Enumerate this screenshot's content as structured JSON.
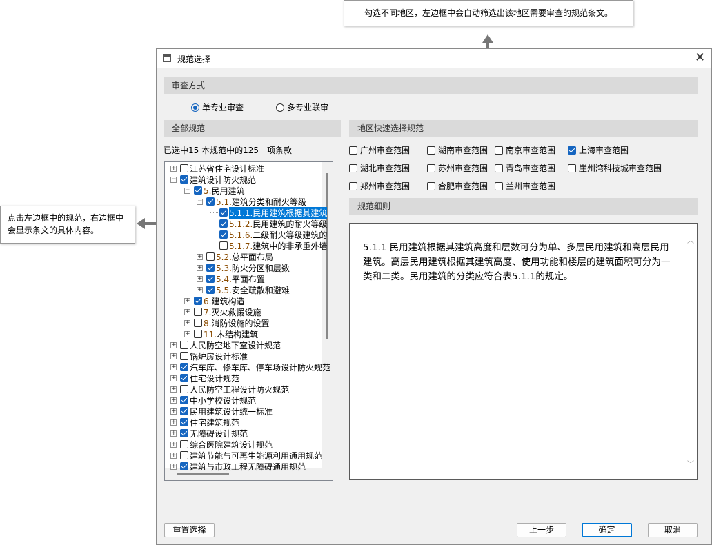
{
  "annotations": {
    "top": "勾选不同地区，左边框中会自动筛选出该地区需要审查的规范条文。",
    "left": "点击左边框中的规范，右边框中会显示条文的具体内容。"
  },
  "dialog": {
    "title": "规范选择",
    "review_mode": {
      "header": "审查方式",
      "options": [
        {
          "label": "单专业审查",
          "selected": true
        },
        {
          "label": "多专业联审",
          "selected": false
        }
      ]
    },
    "all_specs": {
      "header": "全部规范",
      "summary": "已选中15 本规范中的125　项条款"
    },
    "tree": [
      {
        "label": "江苏省住宅设计标准",
        "level": 0,
        "checked": false,
        "exp": "+"
      },
      {
        "label": "建筑设计防火规范",
        "level": 0,
        "checked": true,
        "exp": "-"
      },
      {
        "num": "5.",
        "label": "民用建筑",
        "level": 1,
        "checked": true,
        "exp": "-"
      },
      {
        "num": "5.1.",
        "label": "建筑分类和耐火等级",
        "level": 2,
        "checked": true,
        "exp": "-"
      },
      {
        "num": "5.1.1.",
        "label": "民用建筑根据其建筑",
        "level": 3,
        "checked": true,
        "exp": "",
        "selected": true
      },
      {
        "num": "5.1.2.",
        "label": "民用建筑的耐火等级",
        "level": 3,
        "checked": true,
        "exp": ""
      },
      {
        "num": "5.1.6.",
        "label": "二级耐火等级建筑的",
        "level": 3,
        "checked": true,
        "exp": ""
      },
      {
        "num": "5.1.7.",
        "label": "建筑中的非承重外墙",
        "level": 3,
        "checked": false,
        "exp": ""
      },
      {
        "num": "5.2.",
        "label": "总平面布局",
        "level": 2,
        "checked": false,
        "exp": "+"
      },
      {
        "num": "5.3.",
        "label": "防火分区和层数",
        "level": 2,
        "checked": true,
        "exp": "+"
      },
      {
        "num": "5.4.",
        "label": "平面布置",
        "level": 2,
        "checked": true,
        "exp": "+"
      },
      {
        "num": "5.5.",
        "label": "安全疏散和避难",
        "level": 2,
        "checked": true,
        "exp": "+"
      },
      {
        "num": "6.",
        "label": "建筑构造",
        "level": 1,
        "checked": true,
        "exp": "+"
      },
      {
        "num": "7.",
        "label": "灭火救援设施",
        "level": 1,
        "checked": false,
        "exp": "+"
      },
      {
        "num": "8.",
        "label": "消防设施的设置",
        "level": 1,
        "checked": false,
        "exp": "+"
      },
      {
        "num": "11.",
        "label": "木结构建筑",
        "level": 1,
        "checked": false,
        "exp": "+"
      },
      {
        "label": "人民防空地下室设计规范",
        "level": 0,
        "checked": false,
        "exp": "+"
      },
      {
        "label": "锅炉房设计标准",
        "level": 0,
        "checked": false,
        "exp": "+"
      },
      {
        "label": "汽车库、修车库、停车场设计防火规范",
        "level": 0,
        "checked": true,
        "exp": "+"
      },
      {
        "label": "住宅设计规范",
        "level": 0,
        "checked": true,
        "exp": "+"
      },
      {
        "label": "人民防空工程设计防火规范",
        "level": 0,
        "checked": false,
        "exp": "+"
      },
      {
        "label": "中小学校设计规范",
        "level": 0,
        "checked": true,
        "exp": "+"
      },
      {
        "label": "民用建筑设计统一标准",
        "level": 0,
        "checked": true,
        "exp": "+"
      },
      {
        "label": "住宅建筑规范",
        "level": 0,
        "checked": true,
        "exp": "+"
      },
      {
        "label": "无障碍设计规范",
        "level": 0,
        "checked": true,
        "exp": "+"
      },
      {
        "label": "综合医院建筑设计规范",
        "level": 0,
        "checked": false,
        "exp": "+"
      },
      {
        "label": "建筑节能与可再生能源利用通用规范",
        "level": 0,
        "checked": false,
        "exp": "+"
      },
      {
        "label": "建筑与市政工程无障碍通用规范",
        "level": 0,
        "checked": true,
        "exp": "+"
      }
    ],
    "region": {
      "header": "地区快速选择规范",
      "items": [
        {
          "label": "广州审查范围",
          "checked": false
        },
        {
          "label": "湖南审查范围",
          "checked": false
        },
        {
          "label": "南京审查范围",
          "checked": false
        },
        {
          "label": "上海审查范围",
          "checked": true
        },
        {
          "label": "湖北审查范围",
          "checked": false
        },
        {
          "label": "苏州审查范围",
          "checked": false
        },
        {
          "label": "青岛审查范围",
          "checked": false
        },
        {
          "label": "崖州湾科技城审查范围",
          "checked": false
        },
        {
          "label": "郑州审查范围",
          "checked": false
        },
        {
          "label": "合肥审查范围",
          "checked": false
        },
        {
          "label": "兰州审查范围",
          "checked": false
        }
      ]
    },
    "detail": {
      "header": "规范细则",
      "text": "5.1.1 民用建筑根据其建筑高度和层数可分为单、多层民用建筑和高层民用建筑。高层民用建筑根据其建筑高度、使用功能和楼层的建筑面积可分为一类和二类。民用建筑的分类应符合表5.1.1的规定。"
    },
    "buttons": {
      "reset": "重置选择",
      "prev": "上一步",
      "ok": "确定",
      "cancel": "取消"
    }
  }
}
